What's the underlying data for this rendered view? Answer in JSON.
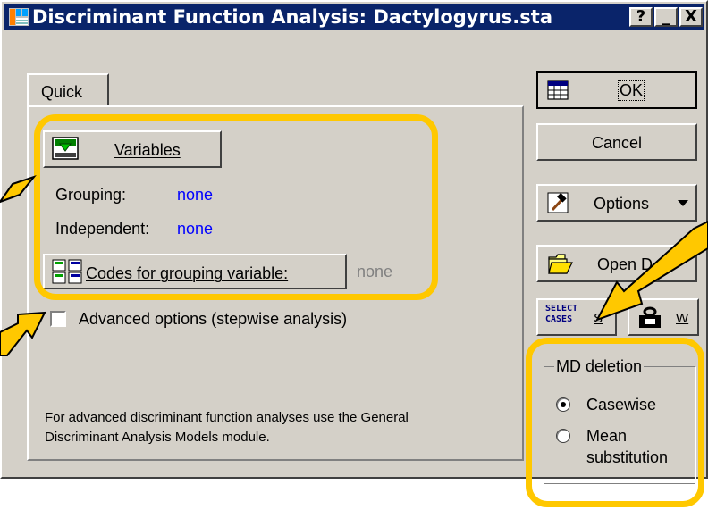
{
  "window": {
    "title": "Discriminant Function Analysis: Dactylogyrus.sta",
    "help_btn": "?",
    "min_btn": "_",
    "close_btn": "X"
  },
  "tabs": [
    {
      "label": "Quick"
    }
  ],
  "variables": {
    "button_label": "Variables",
    "grouping_label": "Grouping:",
    "grouping_value": "none",
    "independent_label": "Independent:",
    "independent_value": "none",
    "codes_button_label": "Codes for grouping variable:",
    "codes_value": "none"
  },
  "advanced": {
    "label": "Advanced options (stepwise analysis)",
    "checked": false
  },
  "info_text": {
    "line1": "For advanced discriminant function analyses use the General",
    "line2": "Discriminant Analysis Models module."
  },
  "side_buttons": {
    "ok": "OK",
    "cancel": "Cancel",
    "options": "Options",
    "open": "Open D",
    "select_cases_top": "SELECT",
    "select_cases_bottom": "CASES",
    "select_cases_key": "S",
    "weight_key": "W"
  },
  "md_deletion": {
    "legend": "MD deletion",
    "options": [
      {
        "label": "Casewise",
        "selected": true
      },
      {
        "label": "Mean",
        "label2": "substitution",
        "selected": false
      }
    ]
  },
  "colors": {
    "highlight": "#ffc800",
    "titlebar": "#0a246a",
    "dialog": "#d4d0c8",
    "link_blue": "#0000ff"
  }
}
